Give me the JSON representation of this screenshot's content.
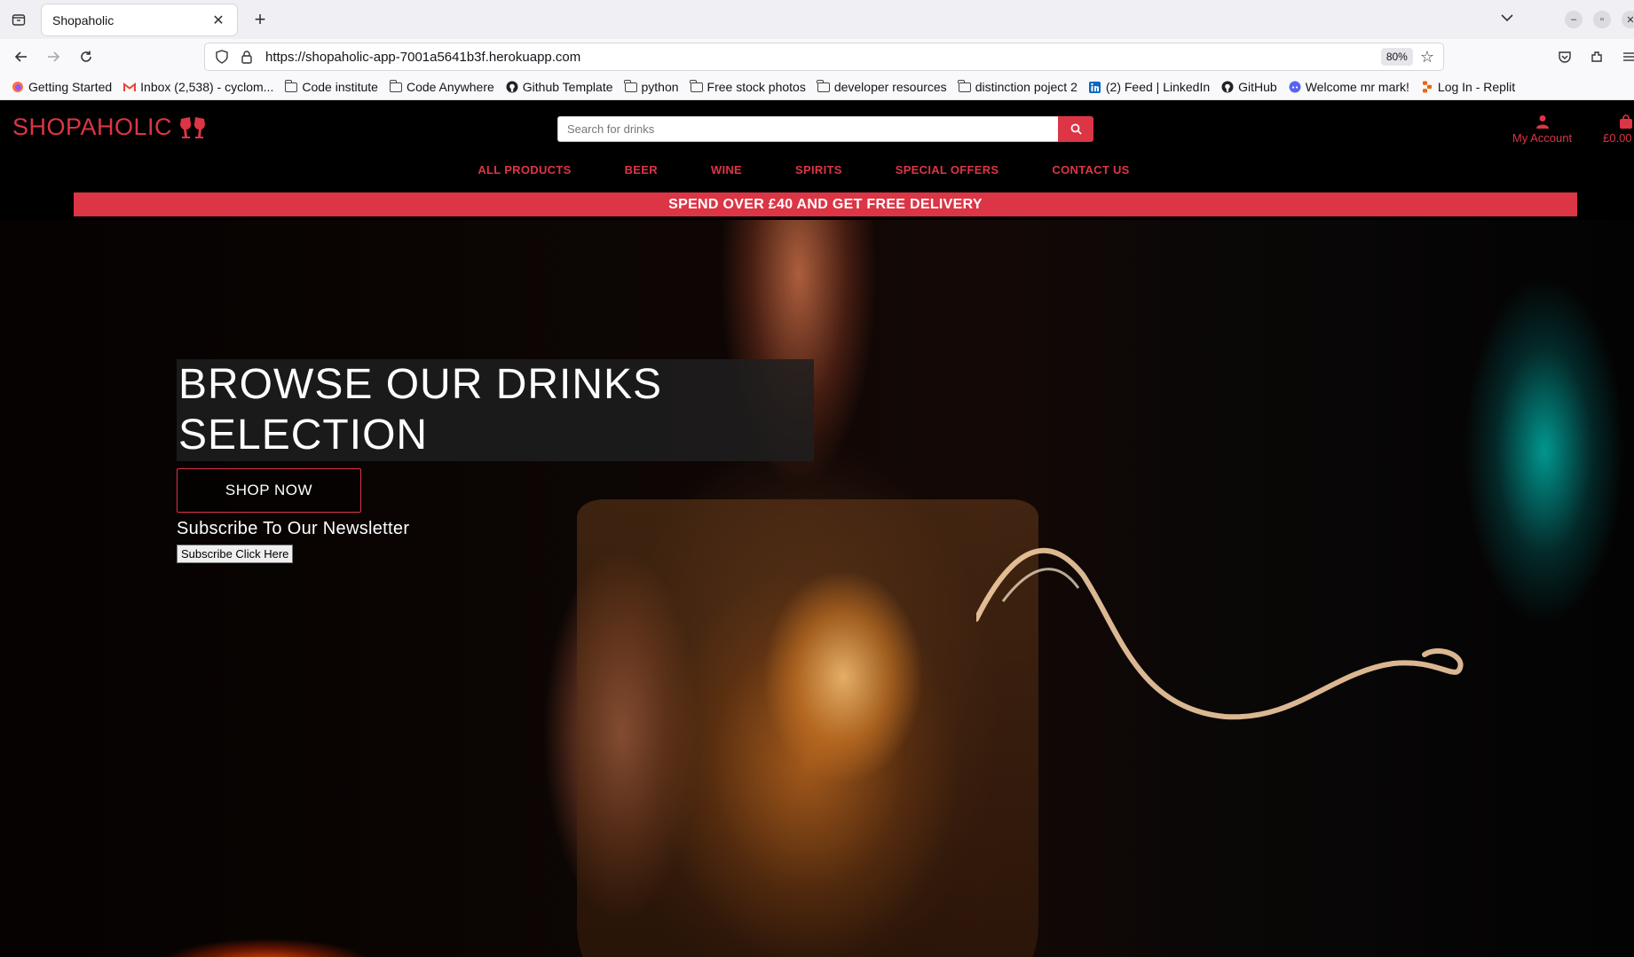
{
  "browser": {
    "tab_title": "Shopaholic",
    "url": "https://shopaholic-app-7001a5641b3f.herokuapp.com",
    "zoom": "80%",
    "bookmarks": [
      {
        "label": "Getting Started",
        "icon": "firefox-icon"
      },
      {
        "label": "Inbox (2,538) - cyclom...",
        "icon": "gmail-icon"
      },
      {
        "label": "Code institute",
        "icon": "folder-icon"
      },
      {
        "label": "Code Anywhere",
        "icon": "folder-icon"
      },
      {
        "label": "Github Template",
        "icon": "github-icon"
      },
      {
        "label": "python",
        "icon": "folder-icon"
      },
      {
        "label": "Free stock photos",
        "icon": "folder-icon"
      },
      {
        "label": "developer resources",
        "icon": "folder-icon"
      },
      {
        "label": "distinction poject 2",
        "icon": "folder-icon"
      },
      {
        "label": "(2) Feed | LinkedIn",
        "icon": "linkedin-icon"
      },
      {
        "label": "GitHub",
        "icon": "github-icon"
      },
      {
        "label": "Welcome mr mark!",
        "icon": "discord-icon"
      },
      {
        "label": "Log In - Replit",
        "icon": "replit-icon"
      }
    ]
  },
  "site": {
    "logo": "SHOPAHOLIC",
    "search_placeholder": "Search for drinks",
    "account_label": "My Account",
    "bag_total": "£0.00",
    "nav": [
      "ALL PRODUCTS",
      "BEER",
      "WINE",
      "SPIRITS",
      "SPECIAL OFFERS",
      "CONTACT US"
    ],
    "banner": "SPEND OVER £40 AND GET FREE DELIVERY",
    "hero": {
      "heading_line1": "BROWSE OUR DRINKS",
      "heading_line2": "SELECTION",
      "shop_button": "SHOP NOW",
      "newsletter_title": "Subscribe To Our Newsletter",
      "subscribe_button": "Subscribe Click Here"
    },
    "colors": {
      "accent": "#dc3545",
      "background": "#000000"
    }
  }
}
